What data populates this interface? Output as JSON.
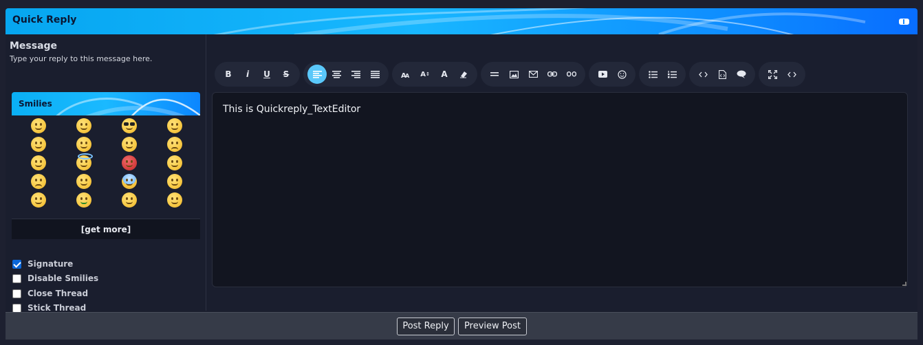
{
  "header": {
    "title": "Quick Reply"
  },
  "message": {
    "label": "Message",
    "description": "Type your reply to this message here."
  },
  "smilies": {
    "title": "Smilies",
    "get_more": "[get more]",
    "icons": [
      "smile-icon",
      "wink-icon",
      "cool-icon",
      "grin-icon",
      "tongue-icon",
      "smirk-icon",
      "happy-icon",
      "frown-icon",
      "confused-icon",
      "angel-icon",
      "angry-icon",
      "blush-icon",
      "mad-icon",
      "sneeze-icon",
      "scream-icon",
      "kiss-icon",
      "eek-icon",
      "money-icon",
      "relieved-icon",
      "rolleyes-icon"
    ]
  },
  "options": [
    {
      "label": "Signature",
      "checked": true
    },
    {
      "label": "Disable Smilies",
      "checked": false
    },
    {
      "label": "Close Thread",
      "checked": false
    },
    {
      "label": "Stick Thread",
      "checked": false
    }
  ],
  "toolbar": {
    "bold": "B",
    "italic": "i",
    "underline": "U",
    "strike": "S",
    "font_size": "A",
    "text_color": "A"
  },
  "editor": {
    "content": "This is Quickreply_TextEditor"
  },
  "footer": {
    "post_reply": "Post Reply",
    "preview_post": "Preview Post"
  },
  "colors": {
    "accent": "#5ac8fa",
    "header_blue": "#18b7ff",
    "checkbox": "#0a66d8"
  }
}
